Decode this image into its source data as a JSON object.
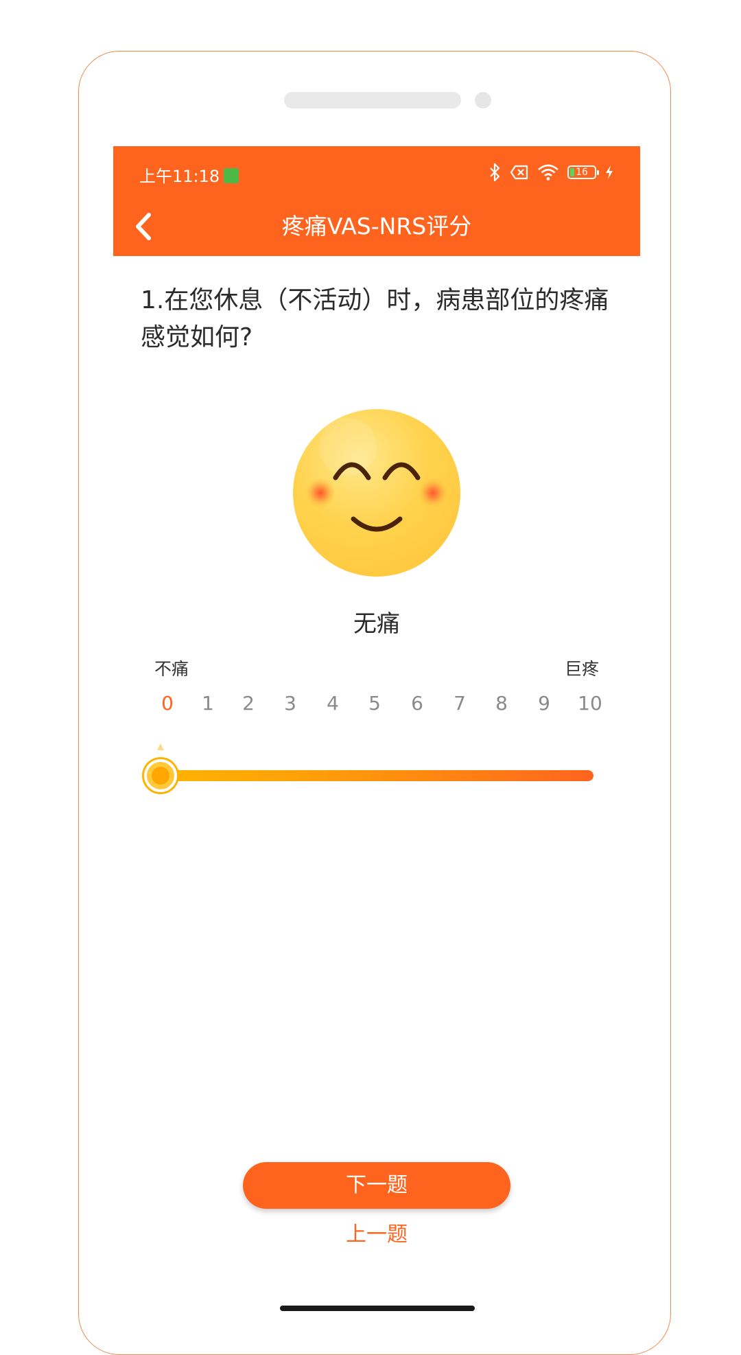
{
  "status_bar": {
    "time": "上午11:18",
    "battery": "16"
  },
  "header": {
    "title": "疼痛VAS-NRS评分"
  },
  "question": {
    "text": "1.在您休息（不活动）时，病患部位的疼痛感觉如何?"
  },
  "pain": {
    "current_label": "无痛",
    "selected_value": 0,
    "min_label": "不痛",
    "max_label": "巨疼",
    "scale": [
      "0",
      "1",
      "2",
      "3",
      "4",
      "5",
      "6",
      "7",
      "8",
      "9",
      "10"
    ]
  },
  "buttons": {
    "next": "下一题",
    "prev": "上一题"
  },
  "colors": {
    "primary": "#ff641e",
    "face": "#ffd24d"
  }
}
